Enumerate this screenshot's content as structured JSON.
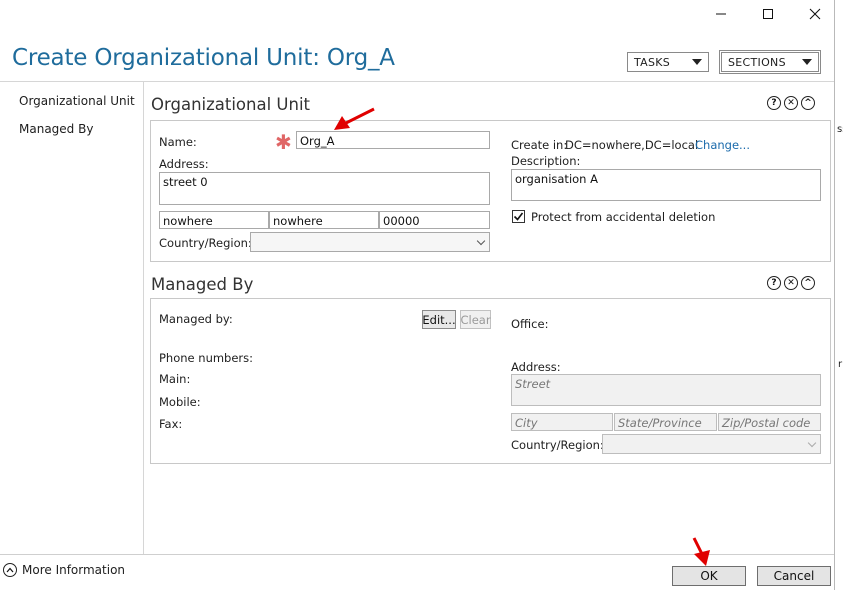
{
  "window": {
    "title": "Create Organizational Unit: Org_A",
    "minimize_glyph": "—",
    "maximize_glyph": "☐",
    "close_glyph": "✕"
  },
  "header": {
    "tasks_label": "TASKS",
    "sections_label": "SECTIONS"
  },
  "nav": {
    "items": [
      {
        "label": "Organizational Unit"
      },
      {
        "label": "Managed By"
      }
    ]
  },
  "ou_section": {
    "title": "Organizational Unit",
    "name_label": "Name:",
    "name_value": "Org_A",
    "address_label": "Address:",
    "street_value": "street 0",
    "city_value": "nowhere",
    "state_value": "nowhere",
    "zip_value": "00000",
    "country_label": "Country/Region:",
    "country_value": "",
    "create_in_label": "Create in:",
    "create_in_value": "DC=nowhere,DC=local",
    "change_link": "Change...",
    "description_label": "Description:",
    "description_value": "organisation A",
    "protect_label": "Protect from accidental deletion",
    "protect_checked": true
  },
  "managed_section": {
    "title": "Managed By",
    "managed_by_label": "Managed by:",
    "edit_label": "Edit...",
    "clear_label": "Clear",
    "office_label": "Office:",
    "phone_label": "Phone numbers:",
    "main_label": "Main:",
    "mobile_label": "Mobile:",
    "fax_label": "Fax:",
    "address_label": "Address:",
    "street_placeholder": "Street",
    "city_placeholder": "City",
    "state_placeholder": "State/Province",
    "zip_placeholder": "Zip/Postal code",
    "country_label": "Country/Region:"
  },
  "section_icons": {
    "help": "?",
    "close": "✕",
    "collapse": "^"
  },
  "edge_text": {
    "s1": "ss",
    "s2": "r"
  },
  "footer": {
    "more_info_label": "More Information",
    "ok_label": "OK",
    "cancel_label": "Cancel"
  },
  "colors": {
    "title": "#1f6c9c",
    "link": "#1a6aab",
    "annotation_arrow": "#e00000",
    "required_star": "#e06666"
  }
}
